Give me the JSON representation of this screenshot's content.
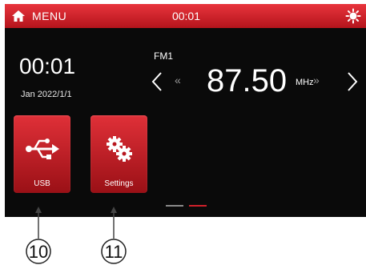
{
  "topbar": {
    "menu_label": "MENU",
    "time": "00:01"
  },
  "clock": {
    "time": "00:01",
    "date": "Jan 2022/1/1"
  },
  "radio": {
    "band": "FM1",
    "frequency": "87.50",
    "unit": "MHz",
    "seek_back_glyph": "«",
    "seek_forward_glyph": "»"
  },
  "apps": [
    {
      "label": "USB",
      "icon": "usb-icon"
    },
    {
      "label": "Settings",
      "icon": "gears-icon"
    }
  ],
  "page_indicator": {
    "pages": 2,
    "active": 2
  },
  "callouts": [
    "10",
    "11"
  ],
  "colors": {
    "accent": "#d0202a",
    "background": "#0a0a0a",
    "text": "#ffffff"
  }
}
